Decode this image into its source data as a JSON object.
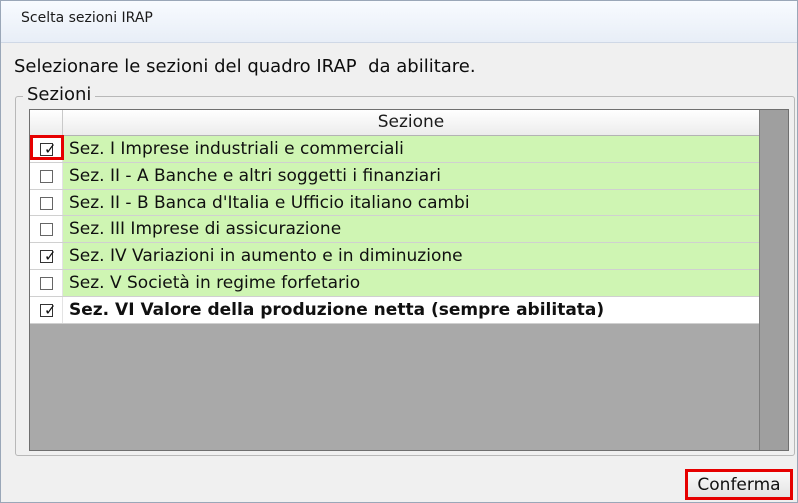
{
  "window": {
    "title": "Scelta sezioni IRAP"
  },
  "dialog": {
    "instruction": "Selezionare le sezioni del quadro IRAP  da abilitare.",
    "group_label": "Sezioni",
    "column_header": "Sezione",
    "confirm_label": "Conferma"
  },
  "sections": [
    {
      "label": "Sez. I Imprese industriali e commerciali",
      "checked": true,
      "highlighted": true,
      "row_color": "#cff5b3"
    },
    {
      "label": "Sez. II - A Banche e altri soggetti i finanziari",
      "checked": false,
      "highlighted": false,
      "row_color": "#cff5b3"
    },
    {
      "label": "Sez. II - B Banca d'Italia e Ufficio italiano cambi",
      "checked": false,
      "highlighted": false,
      "row_color": "#cff5b3"
    },
    {
      "label": "Sez. III Imprese di assicurazione",
      "checked": false,
      "highlighted": false,
      "row_color": "#cff5b3"
    },
    {
      "label": "Sez. IV Variazioni in aumento e in diminuzione",
      "checked": true,
      "highlighted": false,
      "row_color": "#cff5b3"
    },
    {
      "label": "Sez. V Società in regime forfetario",
      "checked": false,
      "highlighted": false,
      "row_color": "#cff5b3"
    },
    {
      "label": "Sez. VI Valore della produzione netta (sempre abilitata)",
      "checked": true,
      "highlighted": false,
      "row_color": "#ffffff",
      "bold": true
    }
  ],
  "colors": {
    "highlight": "#e60000",
    "enabled_row": "#cff5b3",
    "grid_empty": "#a9a9a9"
  },
  "icons": {
    "checked": "checkbox-checked-icon",
    "unchecked": "checkbox-unchecked-icon"
  }
}
